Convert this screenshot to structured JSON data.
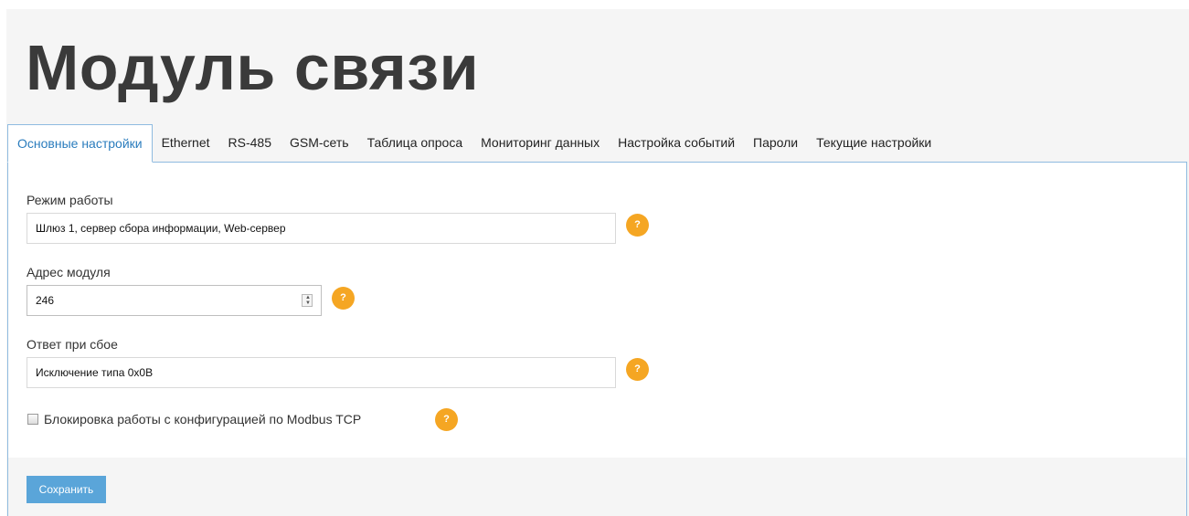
{
  "page": {
    "title": "Модуль связи"
  },
  "tabs": [
    {
      "label": "Основные настройки",
      "active": true
    },
    {
      "label": "Ethernet"
    },
    {
      "label": "RS-485"
    },
    {
      "label": "GSM-сеть"
    },
    {
      "label": "Таблица опроса"
    },
    {
      "label": "Мониторинг данных"
    },
    {
      "label": "Настройка событий"
    },
    {
      "label": "Пароли"
    },
    {
      "label": "Текущие настройки"
    }
  ],
  "form": {
    "mode": {
      "label": "Режим работы",
      "value": "Шлюз 1, сервер сбора информации, Web-сервер"
    },
    "address": {
      "label": "Адрес модуля",
      "value": "246"
    },
    "fault_response": {
      "label": "Ответ при сбое",
      "value": "Исключение типа 0x0B"
    },
    "modbus_lock": {
      "label": "Блокировка работы с конфигурацией по Modbus TCP",
      "checked": false
    },
    "help_symbol": "?"
  },
  "footer": {
    "save_label": "Сохранить"
  },
  "colors": {
    "accent": "#2a7cbd",
    "help": "#f5a623",
    "button": "#5aa5d9",
    "border": "#8fbbe0"
  }
}
